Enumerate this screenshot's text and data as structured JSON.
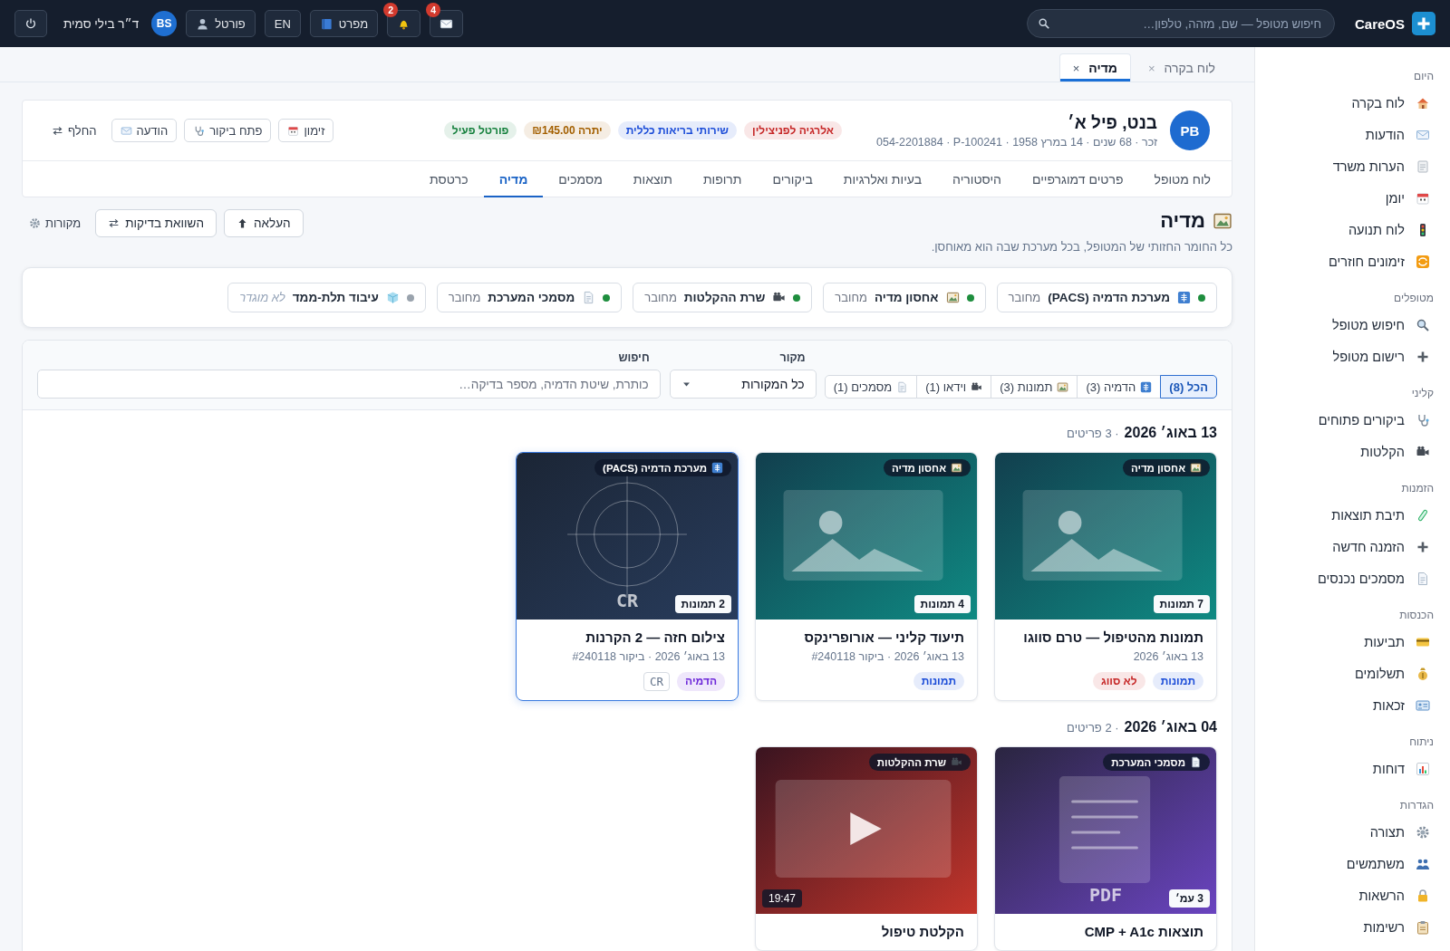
{
  "brand": {
    "name": "CareOS"
  },
  "search": {
    "placeholder": "חיפוש מטופל — שם, מזהה, טלפון…"
  },
  "topbar": {
    "messages_count": "4",
    "alerts_count": "2",
    "guide": "מפרט",
    "language": "EN",
    "portal": "פורטל",
    "user": {
      "initials": "BS",
      "name": "ד״ר בילי סמית"
    }
  },
  "sidebar": [
    {
      "heading": "היום",
      "items": [
        "לוח בקרה",
        "הודעות",
        "הערות משרד",
        "יומן",
        "לוח תנועה",
        "זימונים חוזרים"
      ]
    },
    {
      "heading": "מטופלים",
      "items": [
        "חיפוש מטופל",
        "רישום מטופל"
      ]
    },
    {
      "heading": "קליני",
      "items": [
        "ביקורים פתוחים",
        "הקלטות"
      ]
    },
    {
      "heading": "הזמנות",
      "items": [
        "תיבת תוצאות",
        "הזמנה חדשה",
        "מסמכים נכנסים"
      ]
    },
    {
      "heading": "הכנסות",
      "items": [
        "תביעות",
        "תשלומים",
        "זכאות"
      ]
    },
    {
      "heading": "ניתוח",
      "items": [
        "דוחות"
      ]
    },
    {
      "heading": "הגדרות",
      "items": [
        "תצורה",
        "משתמשים",
        "הרשאות",
        "רשימות"
      ]
    }
  ],
  "open_tabs": [
    {
      "label": "לוח בקרה",
      "close": "×",
      "selected": false
    },
    {
      "label": "מדיה",
      "close": "×",
      "selected": true
    }
  ],
  "patient": {
    "initials": "PB",
    "name": "בנט, פיל א׳",
    "details": [
      "זכר ·",
      "68 שנים ·",
      "14 במרץ 1958 ·",
      "P-100241 ·",
      "054-2201884"
    ],
    "tags": [
      {
        "label": "אלרגיה לפניצילין",
        "color": "#c62828"
      },
      {
        "label": "שירותי בריאות כללית",
        "color": "#1d4ed8"
      },
      {
        "label": "יתרה ₪145.00",
        "color": "#a35f00"
      },
      {
        "label": "פורטל פעיל",
        "color": "#15803d"
      }
    ],
    "actions": [
      {
        "label": "זימון",
        "kind": "button"
      },
      {
        "label": "פתח ביקור",
        "kind": "button"
      },
      {
        "label": "הודעה",
        "kind": "button"
      },
      {
        "label": "החלף",
        "kind": "link"
      }
    ]
  },
  "patient_tabs": [
    {
      "label": "לוח מטופל",
      "selected": false
    },
    {
      "label": "פרטים דמוגרפיים",
      "selected": false
    },
    {
      "label": "היסטוריה",
      "selected": false
    },
    {
      "label": "בעיות ואלרגיות",
      "selected": false
    },
    {
      "label": "ביקורים",
      "selected": false
    },
    {
      "label": "תרופות",
      "selected": false
    },
    {
      "label": "תוצאות",
      "selected": false
    },
    {
      "label": "מסמכים",
      "selected": false
    },
    {
      "label": "מדיה",
      "selected": true
    },
    {
      "label": "כרטסת",
      "selected": false
    }
  ],
  "media": {
    "title": "מדיה",
    "subtitle": "כל החומר החזותי של המטופל, בכל מערכת שבה הוא מאוחסן.",
    "actions": [
      {
        "label": "העלאה",
        "kind": "button"
      },
      {
        "label": "השוואת בדיקות",
        "kind": "button"
      },
      {
        "label": "מקורות",
        "kind": "link"
      }
    ]
  },
  "sources": [
    {
      "name": "מערכת הדמיה (PACS)",
      "status": "מחובר",
      "connected": true
    },
    {
      "name": "אחסון מדיה",
      "status": "מחובר",
      "connected": true
    },
    {
      "name": "שרת ההקלטות",
      "status": "מחובר",
      "connected": true
    },
    {
      "name": "מסמכי המערכת",
      "status": "מחובר",
      "connected": true
    },
    {
      "name": "עיבוד תלת-ממד",
      "status": "לא מוגדר",
      "connected": false
    }
  ],
  "filters": {
    "chips": [
      {
        "label": "הכל (8)",
        "selected": true
      },
      {
        "label": "הדמיה (3)",
        "selected": false
      },
      {
        "label": "תמונות (3)",
        "selected": false
      },
      {
        "label": "וידאו (1)",
        "selected": false
      },
      {
        "label": "מסמכים (1)",
        "selected": false
      }
    ],
    "source_label": "מקור",
    "source_value": "כל המקורות",
    "search_label": "חיפוש",
    "search_placeholder": "כותרת, שיטת הדמיה, מספר בדיקה…"
  },
  "groups": [
    {
      "date": "13 באוג׳ 2026",
      "count": "· 3 פריטים",
      "items": [
        {
          "kind": "photo",
          "selected": false,
          "source": "אחסון מדיה",
          "badge": "7 תמונות",
          "title": "תמונות מהטיפול — טרם סווגו",
          "meta": "13 באוג׳ 2026",
          "tags": [
            {
              "label": "תמונות",
              "kind": "pill",
              "color": "#1d4ed8"
            },
            {
              "label": "לא סווג",
              "kind": "pill",
              "color": "#c62828"
            }
          ]
        },
        {
          "kind": "photo",
          "selected": false,
          "source": "אחסון מדיה",
          "badge": "4 תמונות",
          "title": "תיעוד קליני — אורופרינקס",
          "meta": "13 באוג׳ 2026 · ביקור #240118",
          "tags": [
            {
              "label": "תמונות",
              "kind": "pill",
              "color": "#1d4ed8"
            }
          ]
        },
        {
          "kind": "imaging",
          "selected": true,
          "source": "מערכת הדמיה (PACS)",
          "badge": "2 תמונות",
          "art_label": "CR",
          "title": "צילום חזה — 2 הקרנות",
          "meta": "13 באוג׳ 2026 · ביקור #240118",
          "tags": [
            {
              "label": "הדמיה",
              "kind": "pill",
              "color": "#6d28d9"
            },
            {
              "label": "CR",
              "kind": "code",
              "color": "#64748b"
            }
          ]
        }
      ]
    },
    {
      "date": "04 באוג׳ 2026",
      "count": "· 2 פריטים",
      "items": [
        {
          "kind": "document",
          "selected": false,
          "source": "מסמכי המערכת",
          "badge": "3 עמ׳",
          "art_label": "PDF",
          "title": "תוצאות CMP + A1c"
        },
        {
          "kind": "video",
          "selected": false,
          "source": "שרת ההקלטות",
          "badge": "19:47",
          "title": "הקלטת טיפול"
        }
      ]
    }
  ]
}
